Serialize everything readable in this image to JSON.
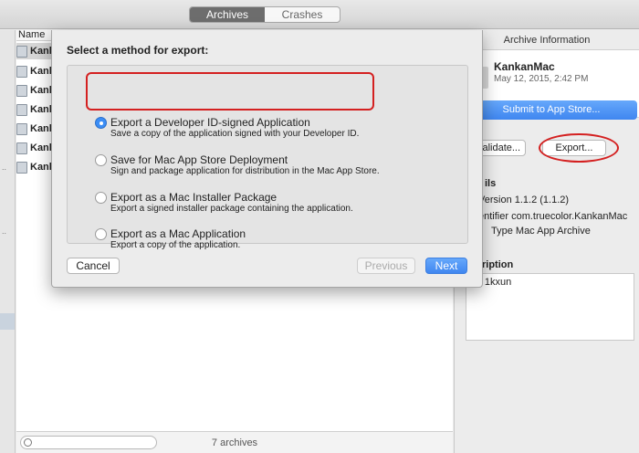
{
  "toolbar": {
    "tabs": [
      "Archives",
      "Crashes"
    ],
    "active_tab": "Archives"
  },
  "list": {
    "column_header": "Name",
    "rows": [
      "Kankan",
      "Kankan",
      "Kankan",
      "Kankan",
      "Kankan",
      "Kankan",
      "Kankan"
    ],
    "footer_count": "7 archives"
  },
  "right_panel": {
    "title": "Archive Information",
    "app_name": "KankanMac",
    "app_date": "May 12, 2015, 2:42 PM",
    "submit_label": "Submit to App Store...",
    "validate_label": "Validate...",
    "export_label": "Export...",
    "details_heading": "ils",
    "version_line": "Version 1.1.2 (1.1.2)",
    "identifier_line": "entifier com.truecolor.KankanMac",
    "type_line": "Type Mac App Archive",
    "description_heading": "ription",
    "description_text": "2 - 1kxun"
  },
  "sheet": {
    "title": "Select a method for export:",
    "options": [
      {
        "title": "Export a Developer ID-signed Application",
        "subtitle": "Save a copy of the application signed with your Developer ID.",
        "selected": true
      },
      {
        "title": "Save for Mac App Store Deployment",
        "subtitle": "Sign and package application for distribution in the Mac App Store.",
        "selected": false
      },
      {
        "title": "Export as a Mac Installer Package",
        "subtitle": "Export a signed installer package containing the application.",
        "selected": false
      },
      {
        "title": "Export as a Mac Application",
        "subtitle": "Export a copy of the application.",
        "selected": false
      }
    ],
    "cancel_label": "Cancel",
    "previous_label": "Previous",
    "next_label": "Next"
  },
  "colors": {
    "accent": "#3f86f0",
    "annotation": "#d42020"
  },
  "icons": [
    "search-icon",
    "app-archive-icon",
    "radio-button-icon"
  ]
}
